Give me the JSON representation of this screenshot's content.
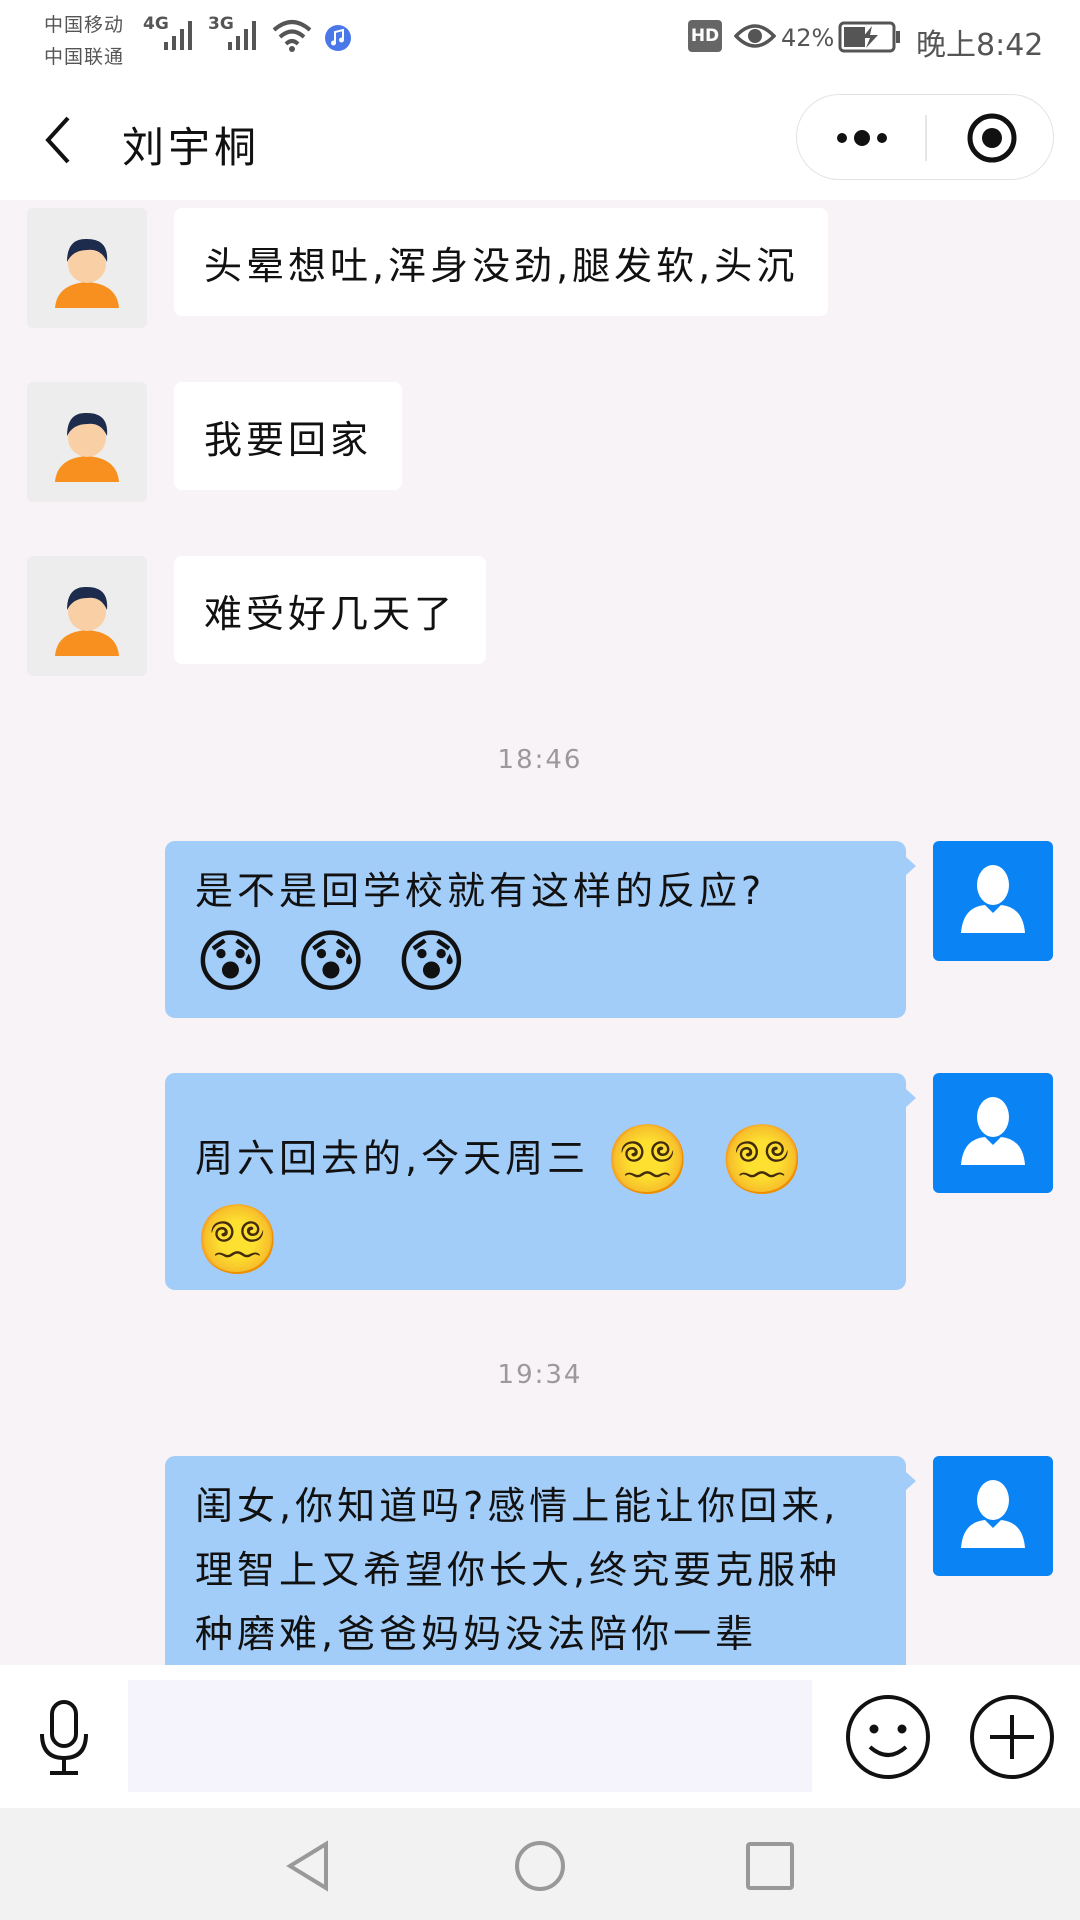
{
  "status_bar": {
    "carrier_1": "中国移动",
    "carrier_2": "中国联通",
    "network_1": "4G",
    "network_2": "3G",
    "hd_badge": "HD",
    "battery_percent": "42%",
    "time": "晚上8:42",
    "icons": [
      "signal-icon",
      "wifi-icon",
      "music-icon",
      "eye-icon",
      "battery-icon"
    ]
  },
  "nav": {
    "title": "刘宇桐",
    "icons": [
      "back-icon",
      "more-icon",
      "close-target-icon"
    ]
  },
  "messages_in": [
    {
      "text": "头晕想吐,浑身没劲,腿发软,头沉"
    },
    {
      "text": "我要回家"
    },
    {
      "text": "难受好几天了"
    }
  ],
  "timestamps": [
    "18:46",
    "19:34"
  ],
  "messages_out": [
    {
      "text": "是不是回学校就有这样的反应?",
      "emojis": "😰 😰 😰"
    },
    {
      "text": "周六回去的,今天周三",
      "emojis": "😵‍💫 😵‍💫 😵‍💫"
    },
    {
      "text": "闺女,你知道吗?感情上能让你回来,理智上又希望你长大,终究要克服种种磨难,爸爸妈妈没法陪你一辈"
    }
  ],
  "input": {
    "value": "",
    "icons": [
      "microphone-icon",
      "smiley-icon",
      "plus-icon"
    ]
  },
  "colors": {
    "accent_blue": "#0a84f4",
    "outgoing_bubble": "#a3cdf9",
    "chat_background": "#f8f3f6"
  }
}
